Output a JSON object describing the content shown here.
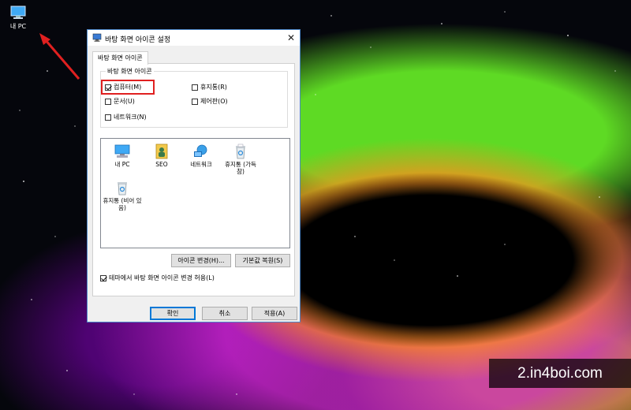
{
  "desktop": {
    "icon_label": "내 PC",
    "watermark": "2.in4boi.com"
  },
  "dialog": {
    "title": "바탕 화면 아이콘 설정",
    "close_glyph": "✕",
    "tab_label": "바탕 화면 아이콘",
    "group_label": "바탕 화면 아이콘",
    "checkboxes": [
      {
        "label": "컴퓨터(M)",
        "checked": true
      },
      {
        "label": "휴지통(R)",
        "checked": false
      },
      {
        "label": "문서(U)",
        "checked": false
      },
      {
        "label": "제어판(O)",
        "checked": false
      },
      {
        "label": "네트워크(N)",
        "checked": false
      }
    ],
    "icons": [
      {
        "label": "내 PC",
        "icon": "computer-icon"
      },
      {
        "label": "SEO",
        "icon": "user-folder-icon"
      },
      {
        "label": "네트워크",
        "icon": "network-icon"
      },
      {
        "label": "휴지통 (가득 참)",
        "icon": "recycle-bin-full-icon"
      },
      {
        "label": "휴지통 (비어 있음)",
        "icon": "recycle-bin-empty-icon"
      }
    ],
    "change_icon_label": "아이콘 변경(H)...",
    "restore_default_label": "기본값 복원(S)",
    "allow_theme_label": "테마에서 바탕 화면 아이콘 변경 허용(L)",
    "allow_theme_checked": true,
    "ok_label": "확인",
    "cancel_label": "취소",
    "apply_label": "적용(A)"
  },
  "colors": {
    "highlight": "#e02020",
    "accent": "#0078d7",
    "arrow": "#e02020"
  }
}
